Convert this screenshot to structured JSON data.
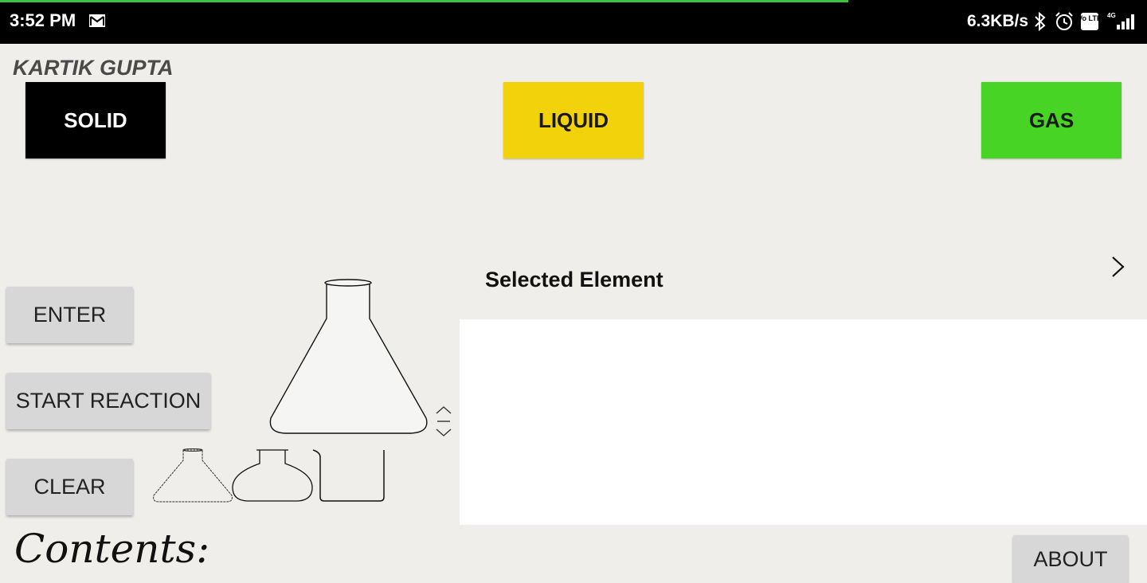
{
  "status_bar": {
    "time": "3:52 PM",
    "network_speed": "6.3KB/s",
    "icons": [
      "gmail-icon",
      "bluetooth-icon",
      "alarm-icon",
      "volte-icon",
      "signal-4g-icon"
    ],
    "volte_label": "Vo LTE",
    "network_type": "4G"
  },
  "header": {
    "user_name": "KARTIK GUPTA"
  },
  "state_buttons": {
    "solid": "SOLID",
    "liquid": "LIQUID",
    "gas": "GAS"
  },
  "colors": {
    "solid": "#000000",
    "liquid": "#f2d20a",
    "gas": "#48d424",
    "progress": "#3cc23c"
  },
  "actions": {
    "enter": "ENTER",
    "start_reaction": "START REACTION",
    "clear": "CLEAR",
    "about": "ABOUT"
  },
  "apparatus": {
    "selected": "conical-flask",
    "options": [
      "conical-flask",
      "round-bottom-flask",
      "beaker"
    ]
  },
  "element_panel": {
    "label": "Selected Element"
  },
  "contents": {
    "label": "Contents:"
  }
}
